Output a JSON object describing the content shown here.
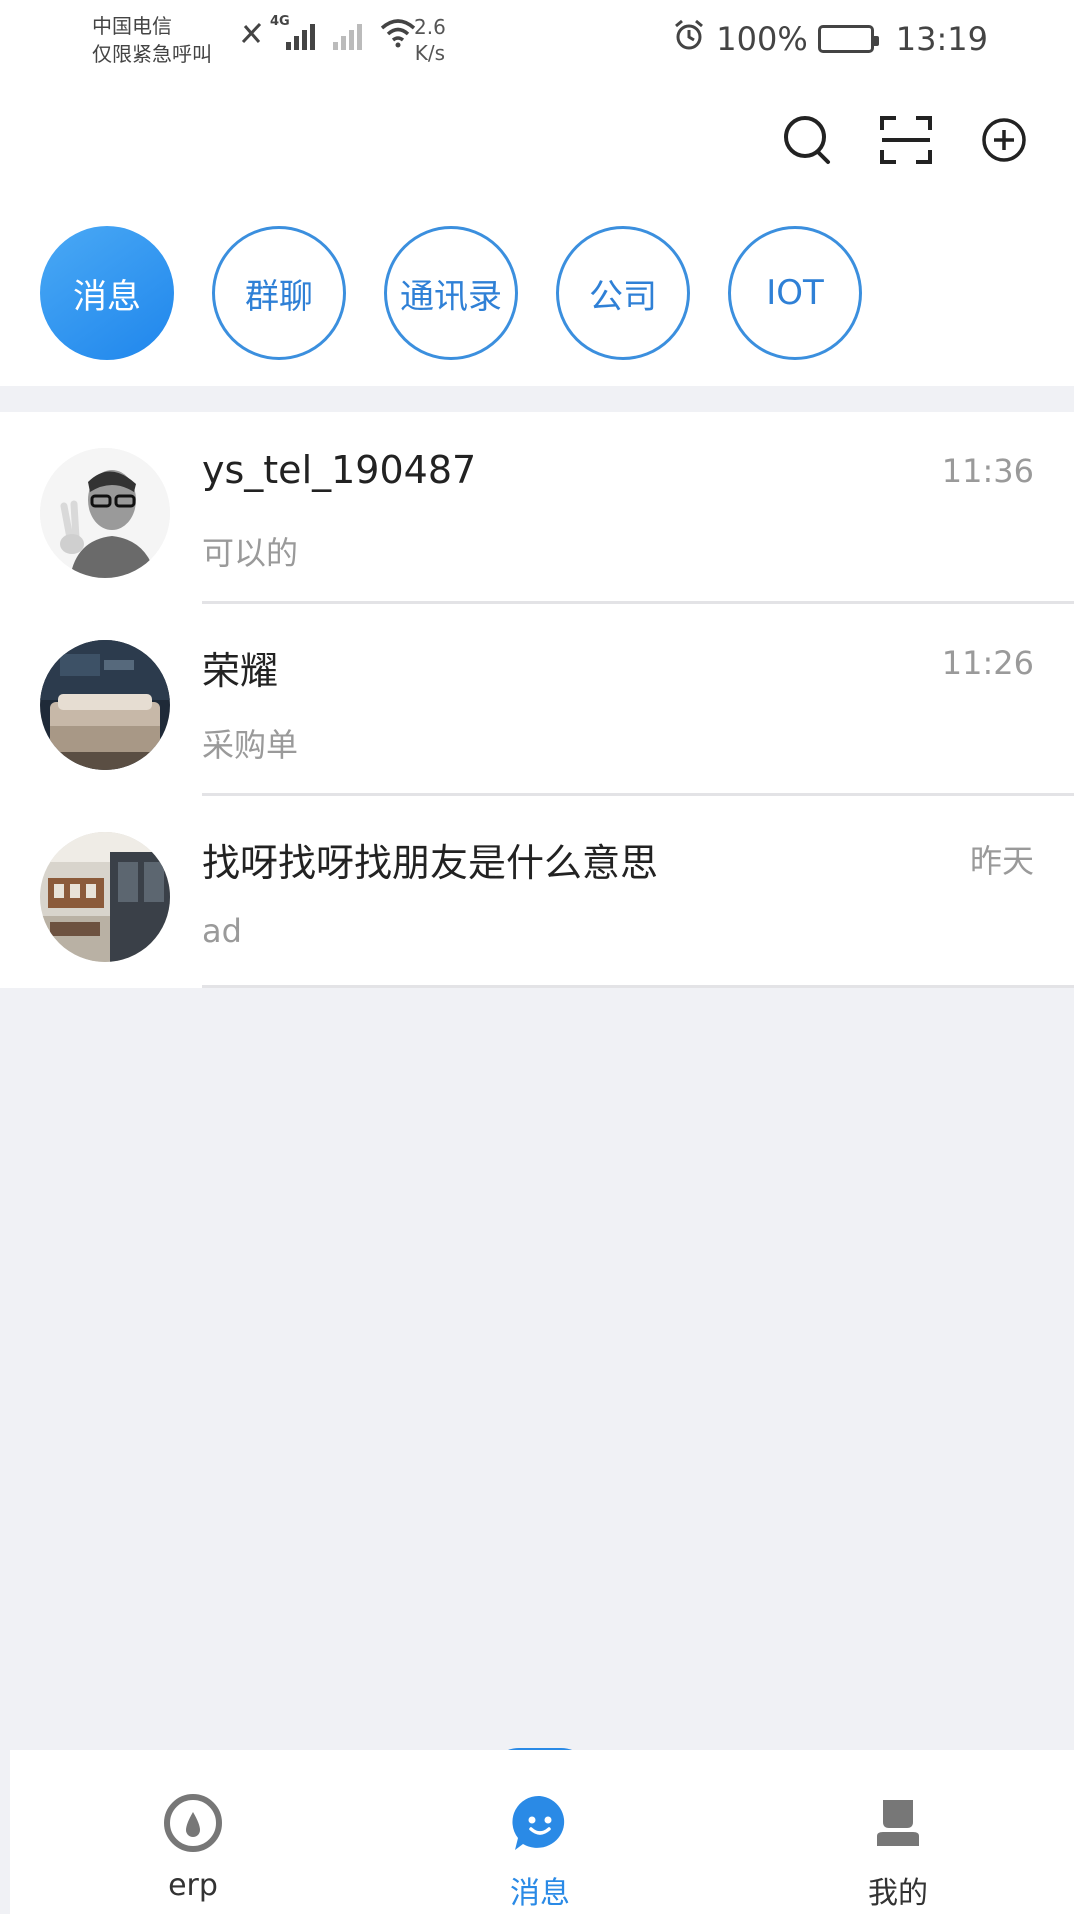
{
  "status_bar": {
    "carrier": "中国电信",
    "emergency": "仅限紧急呼叫",
    "network_type": "4G",
    "net_speed_value": "2.6",
    "net_speed_unit": "K/s",
    "battery": "100%",
    "time": "13:19"
  },
  "header": {
    "actions": [
      "search-icon",
      "scan-icon",
      "add-icon"
    ]
  },
  "tabs": [
    {
      "label": "消息",
      "active": true
    },
    {
      "label": "群聊",
      "active": false
    },
    {
      "label": "通讯录",
      "active": false
    },
    {
      "label": "公司",
      "active": false
    },
    {
      "label": "IOT",
      "active": false
    }
  ],
  "conversations": [
    {
      "name": "ys_tel_190487",
      "preview": "可以的",
      "time": "11:36"
    },
    {
      "name": "荣耀",
      "preview": "采购单",
      "time": "11:26"
    },
    {
      "name": "找呀找呀找朋友是什么意思",
      "preview": "ad",
      "time": "昨天"
    }
  ],
  "bottom_nav": [
    {
      "label": "erp",
      "icon": "erp-icon",
      "active": false
    },
    {
      "label": "消息",
      "icon": "message-icon",
      "active": true
    },
    {
      "label": "我的",
      "icon": "profile-icon",
      "active": false
    }
  ],
  "colors": {
    "accent": "#2a8ae6",
    "tab_border": "#3b8fde",
    "background": "#f0f1f5"
  }
}
